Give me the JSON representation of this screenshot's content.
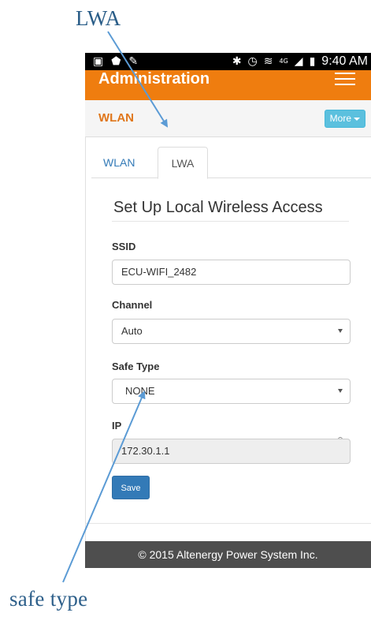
{
  "annotations": {
    "top_label": "LWA",
    "bottom_label": "safe type"
  },
  "status_bar": {
    "time": "9:40 AM",
    "icons_left": [
      "photo-icon",
      "shield-icon",
      "pencil-icon"
    ],
    "icons_right": [
      "bluetooth-icon",
      "alarm-icon",
      "wifi-icon",
      "signal-icon",
      "battery-icon"
    ],
    "lte_label": "4G"
  },
  "app_bar": {
    "title": "Administration",
    "menu_icon": "hamburger-menu-icon"
  },
  "section": {
    "title": "WLAN",
    "more_label": "More"
  },
  "tabs": [
    {
      "label": "WLAN",
      "active": false
    },
    {
      "label": "LWA",
      "active": true
    }
  ],
  "form": {
    "title": "Set Up Local Wireless Access",
    "ssid_label": "SSID",
    "ssid_value": "ECU-WIFI_2482",
    "channel_label": "Channel",
    "channel_value": "Auto",
    "safe_type_label": "Safe Type",
    "safe_type_value": "NONE",
    "ip_label": "IP",
    "ip_value": "172.30.1.1",
    "save_label": "Save"
  },
  "footer": {
    "text": "© 2015 Altenergy Power System Inc."
  },
  "colors": {
    "app_bar": "#ef7d0f",
    "section_title": "#e0761a",
    "more_button": "#5bc0de",
    "save_button": "#337ab7",
    "footer": "#4e4e4e",
    "annotation": "#2a5d88",
    "arrow": "#5b9bd5"
  }
}
